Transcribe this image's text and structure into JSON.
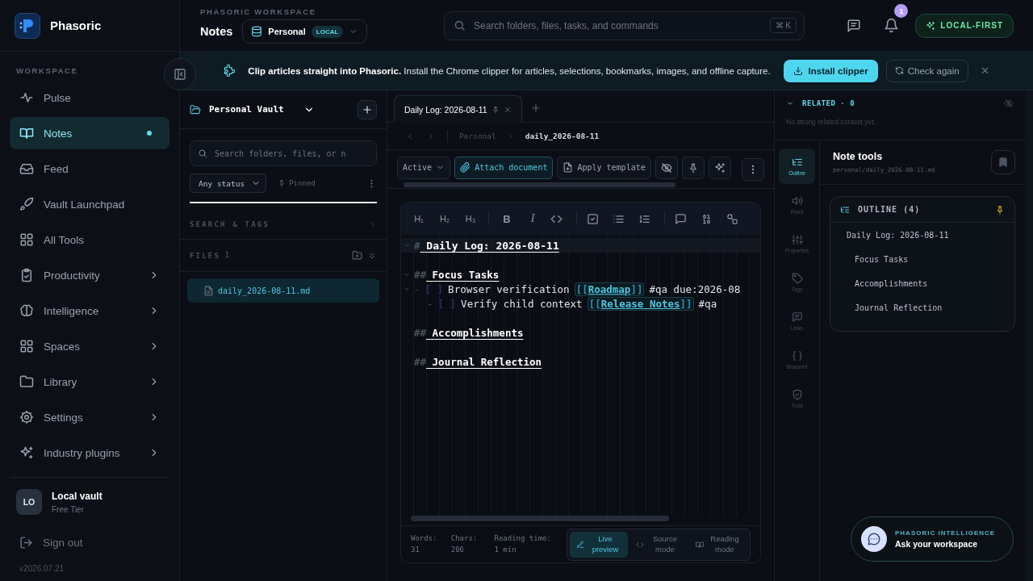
{
  "app": {
    "name": "Phasoric"
  },
  "sidebar": {
    "section": "WORKSPACE",
    "items": [
      {
        "label": "Pulse",
        "selected": false,
        "dot": false,
        "expandable": false
      },
      {
        "label": "Notes",
        "selected": true,
        "dot": true,
        "expandable": false
      },
      {
        "label": "Feed",
        "selected": false,
        "dot": false,
        "expandable": false
      },
      {
        "label": "Vault Launchpad",
        "selected": false,
        "dot": false,
        "expandable": false
      },
      {
        "label": "All Tools",
        "selected": false,
        "dot": false,
        "expandable": false
      },
      {
        "label": "Productivity",
        "selected": false,
        "dot": false,
        "expandable": true
      },
      {
        "label": "Intelligence",
        "selected": false,
        "dot": false,
        "expandable": true
      },
      {
        "label": "Spaces",
        "selected": false,
        "dot": false,
        "expandable": true
      },
      {
        "label": "Library",
        "selected": false,
        "dot": false,
        "expandable": true
      },
      {
        "label": "Settings",
        "selected": false,
        "dot": false,
        "expandable": true
      },
      {
        "label": "Industry plugins",
        "selected": false,
        "dot": false,
        "expandable": true
      }
    ],
    "account": {
      "initials": "LO",
      "name": "Local vault",
      "plan": "Free Tier"
    },
    "sign_out": "Sign out",
    "version": "v2026.07.21"
  },
  "header": {
    "eyebrow": "PHASORIC WORKSPACE",
    "title": "Notes",
    "workspace": "Personal",
    "workspace_badge": "LOCAL",
    "search": {
      "placeholder": "Search folders, files, tasks, and commands",
      "shortcut": "⌘ K"
    },
    "notification_count": "1",
    "mode_badge": "LOCAL-FIRST"
  },
  "banner": {
    "text": "**Clip articles straight into Phasoric.** Install the Chrome clipper for articles, selections, bookmarks, images, and offline capture.",
    "primary": "Install clipper",
    "secondary": "Check again"
  },
  "files_panel": {
    "vault": "Personal Vault",
    "search_placeholder": "Search folders, files, or n",
    "status_filter": "Any status",
    "pinned": "Pinned",
    "section": "SEARCH & TAGS",
    "files_title": "FILES",
    "files_count": "1",
    "files": [
      {
        "name": "daily_2026-08-11.md",
        "selected": true
      }
    ]
  },
  "editor": {
    "tabs": [
      {
        "label": "Daily Log: 2026-08-11",
        "selected": true
      }
    ],
    "breadcrumb": [
      "Personal",
      "daily_2026-08-11"
    ],
    "status_select": "Active",
    "actions": [
      {
        "label": "Attach document",
        "selected": true
      },
      {
        "label": "Apply template",
        "selected": false
      }
    ],
    "format_labels": [
      "H₁",
      "H₂",
      "H₃",
      "B",
      "I"
    ],
    "lines": [
      {
        "kind": "h1",
        "marker": "#",
        "text": "Daily Log: 2026-08-11",
        "foldable": true,
        "current": true
      },
      {
        "kind": "h2",
        "marker": "##",
        "text": "Focus Tasks",
        "foldable": true,
        "current": false
      },
      {
        "kind": "task",
        "bullet": "-",
        "box": "[ ]",
        "checked": false,
        "text": "Browser verification",
        "link": {
          "open": "[[",
          "label": "Roadmap",
          "close": "]]"
        },
        "tail": "#qa due:2026-08",
        "foldable": true,
        "current": false,
        "children": [
          {
            "kind": "task",
            "bullet": "-",
            "box": "[ ]",
            "checked": false,
            "text": "Verify child context",
            "link": {
              "open": "[[",
              "label": "Release Notes",
              "close": "]]"
            },
            "tail": "#qa",
            "foldable": false,
            "current": false
          }
        ]
      },
      {
        "kind": "h2",
        "marker": "##",
        "text": "Accomplishments",
        "foldable": false,
        "current": false
      },
      {
        "kind": "h2",
        "marker": "##",
        "text": "Journal Reflection",
        "foldable": false,
        "current": false
      }
    ],
    "stats": [
      {
        "label": "Words:",
        "value": "31"
      },
      {
        "label": "Chars:",
        "value": "206"
      },
      {
        "label": "Reading time:",
        "value": "1 min"
      }
    ],
    "view_modes": [
      {
        "label": "Live preview",
        "selected": true
      },
      {
        "label": "Source mode",
        "selected": false
      },
      {
        "label": "Reading mode",
        "selected": false
      }
    ]
  },
  "right_panel": {
    "related": {
      "title": "RELATED · 0",
      "expanded": true,
      "empty": "No strong related context yet."
    },
    "rail": [
      {
        "label": "Outline",
        "selected": true
      },
      {
        "label": "Read",
        "selected": false
      },
      {
        "label": "Properties",
        "selected": false
      },
      {
        "label": "Tags",
        "selected": false
      },
      {
        "label": "Links",
        "selected": false
      },
      {
        "label": "Blueprint",
        "selected": false
      },
      {
        "label": "Trust",
        "selected": false
      }
    ],
    "title": "Note tools",
    "path": "personal/daily_2026-08-11.md",
    "outline_title": "OUTLINE (4)",
    "outline": [
      {
        "label": "Daily Log: 2026-08-11",
        "children": [
          {
            "label": "Focus Tasks"
          },
          {
            "label": "Accomplishments"
          },
          {
            "label": "Journal Reflection"
          }
        ]
      }
    ]
  },
  "assistant": {
    "eyebrow": "PHASORIC INTELLIGENCE",
    "title": "Ask your workspace"
  }
}
